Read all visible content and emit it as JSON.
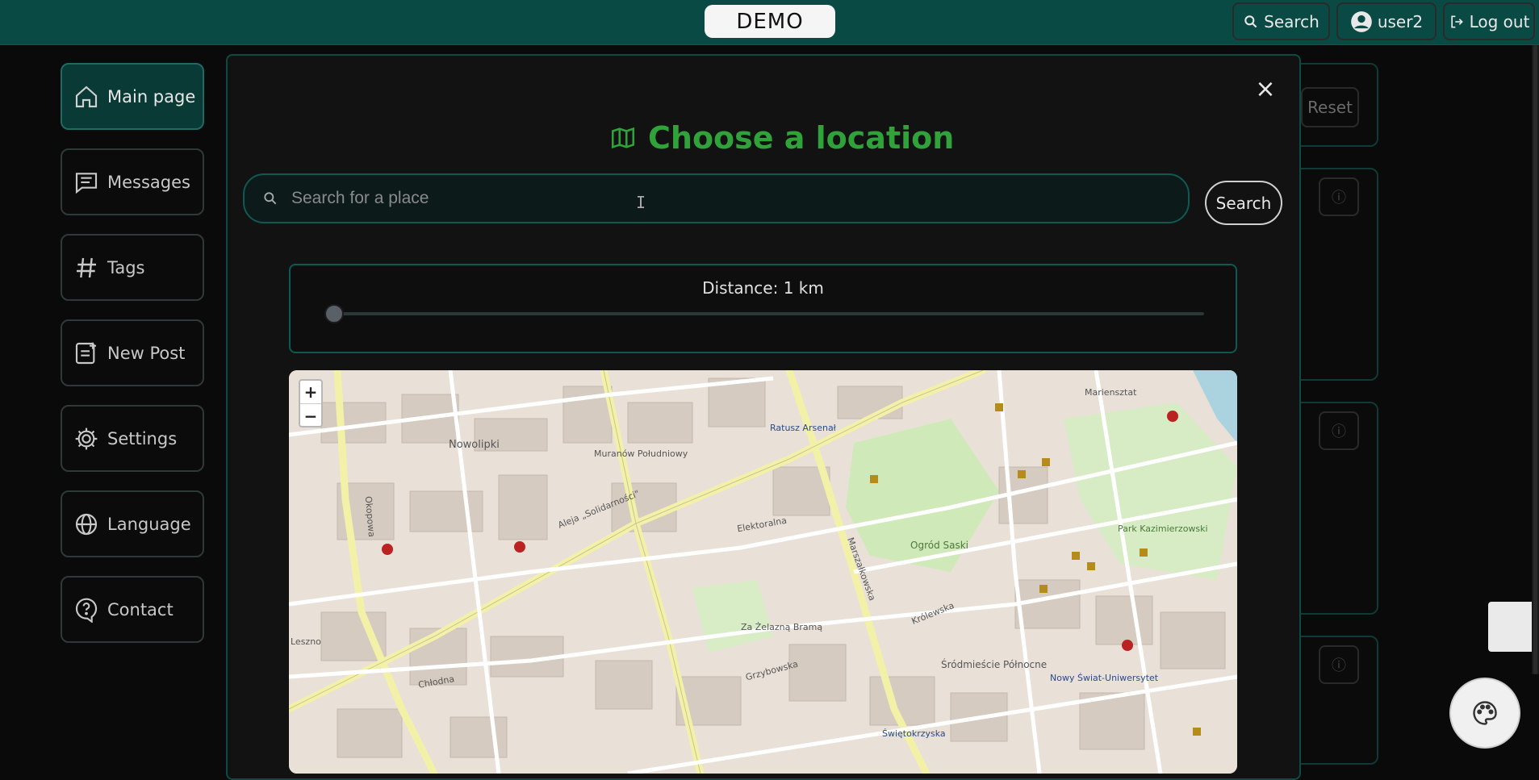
{
  "header": {
    "logo_text": "DEMO",
    "search_label": "Search",
    "user_label": "user2",
    "logout_label": "Log out"
  },
  "sidebar": {
    "items": [
      {
        "label": "Main page",
        "icon": "home-icon"
      },
      {
        "label": "Messages",
        "icon": "message-icon"
      },
      {
        "label": "Tags",
        "icon": "hash-icon"
      },
      {
        "label": "New Post",
        "icon": "new-post-icon"
      },
      {
        "label": "Settings",
        "icon": "gear-icon"
      },
      {
        "label": "Language",
        "icon": "globe-icon"
      },
      {
        "label": "Contact",
        "icon": "help-icon"
      }
    ]
  },
  "background": {
    "reset_label": "Reset"
  },
  "modal": {
    "title": "Choose a location",
    "title_icon": "map-icon",
    "search": {
      "placeholder": "Search for a place",
      "value": "",
      "submit_label": "Search"
    },
    "distance": {
      "label": "Distance: 1 km",
      "value_km": 1
    },
    "map": {
      "zoom_in": "+",
      "zoom_out": "−",
      "labels": [
        "Nowolipki",
        "Muranów Południowy",
        "Ratusz Arsenał",
        "Ogród Saski",
        "Za Żelazną Bramą",
        "Śródmieście Północne",
        "Nowy Świat-Uniwersytet",
        "Świętokrzyska",
        "Park Kazimierzowski",
        "Mariensztat",
        "Aleja „Solidarności\"",
        "Marszałkowska",
        "Królewska",
        "Grzybowska",
        "Okopowa",
        "Leszno",
        "Chłodna",
        "Elektoralna"
      ]
    }
  },
  "colors": {
    "header_bg": "#0a4a44",
    "accent_green": "#2fa33a",
    "border_teal": "#0d5a50"
  }
}
